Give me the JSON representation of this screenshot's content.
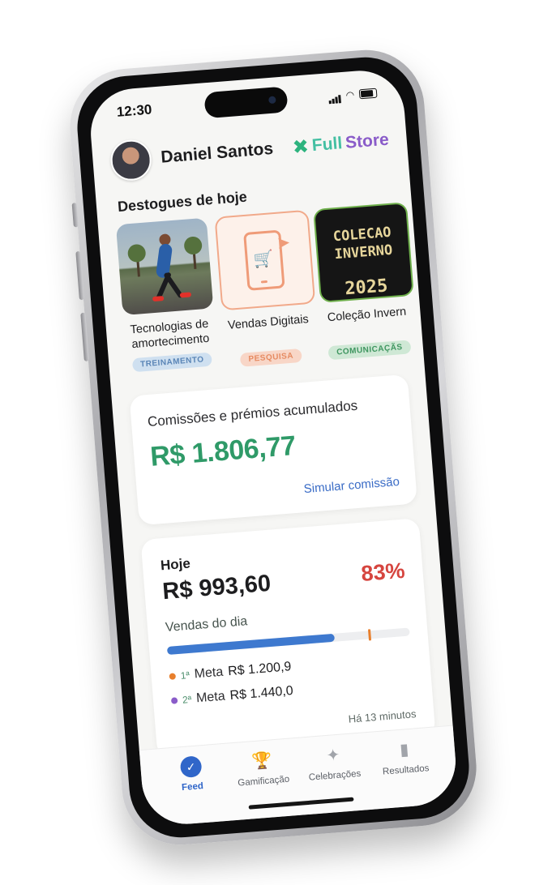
{
  "status_bar": {
    "time": "12:30"
  },
  "header": {
    "user_name": "Daniel Santos",
    "brand_prefix": "Full",
    "brand_suffix": "Store",
    "brand_icon": "store-x-icon"
  },
  "highlights": {
    "title": "Destogues de hoje",
    "items": [
      {
        "label": "Tecnologias de amortecimento",
        "tag": "TREINAMENTO"
      },
      {
        "label": "Vendas Digitais",
        "tag": "PESQUISA"
      },
      {
        "label": "Coleção Invern",
        "tag": "COMUNICAÇÃS",
        "thumb_text": "COLECAO\nINVERNO",
        "thumb_year": "2025"
      }
    ]
  },
  "commissions": {
    "title": "Comissões e prémios acumulados",
    "value": "R$ 1.806,77",
    "link": "Simular comissão"
  },
  "today": {
    "label": "Hoje",
    "value": "R$ 993,60",
    "percent": "83%",
    "subtitle": "Vendas do dia",
    "progress_fraction": 0.69,
    "meta_marker_fraction": 0.83,
    "metas": [
      {
        "rank": "1ª",
        "label": "Meta",
        "value": "R$ 1.200,9",
        "color": "#e87f2c"
      },
      {
        "rank": "2ª",
        "label": "Meta",
        "value": "R$ 1.440,0",
        "color": "#8a5cc9"
      }
    ],
    "updated": "Há 13 minutos"
  },
  "tabbar": {
    "items": [
      {
        "label": "Feed",
        "icon": "feed-icon",
        "active": true
      },
      {
        "label": "Gamificação",
        "icon": "trophy-icon",
        "active": false
      },
      {
        "label": "Celebrações",
        "icon": "party-icon",
        "active": false
      },
      {
        "label": "Resultados",
        "icon": "chart-icon",
        "active": false
      }
    ]
  },
  "colors": {
    "accent": "#3066c9",
    "money_green": "#2f9a68",
    "percent_red": "#d6453f"
  }
}
